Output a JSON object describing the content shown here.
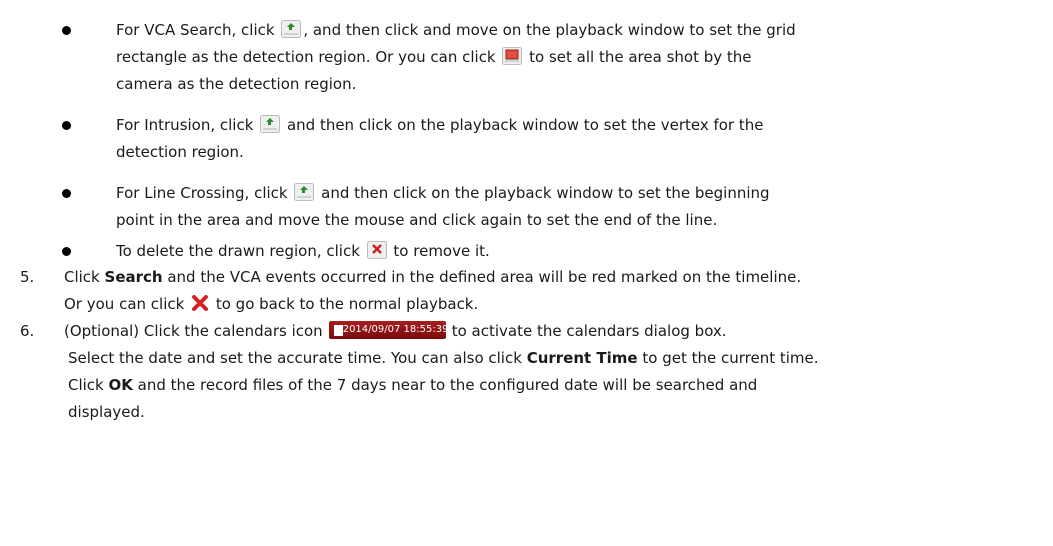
{
  "b1": {
    "l1a": "For VCA Search, click ",
    "l1b": ", and then click and move on the playback window to set the grid",
    "l2a": "rectangle as the detection region. Or you can click ",
    "l2b": " to set all the area shot by the",
    "l3": "camera as the detection region."
  },
  "b2": {
    "l1a": "For Intrusion, click ",
    "l1b": " and then click on the playback window to set the vertex for the",
    "l2": "detection region."
  },
  "b3": {
    "l1a": "For Line Crossing, click ",
    "l1b": " and then click on the playback window to set the beginning",
    "l2": "point in the area and move the mouse and click again to set the end of the line."
  },
  "b4": {
    "l1a": "To delete the drawn region, click ",
    "l1b": " to remove it."
  },
  "s5": {
    "num": "5.",
    "l1a": "Click ",
    "l1bold": "Search",
    "l1b": " and the VCA events occurred in the defined area will be red marked on the timeline.",
    "l2a": "Or you can click ",
    "l2b": " to go back to the normal playback."
  },
  "s6": {
    "num": "6.",
    "l1a": "(Optional) Click the calendars icon",
    "date": "2014/09/07 18:55:39",
    "l1b": "to activate the calendars dialog box.",
    "l2a": "Select the date and set the accurate time. You can also click ",
    "l2bold": "Current Time",
    "l2b": " to get the current time.",
    "l3a": "Click ",
    "l3bold": "OK",
    "l3b": " and the record files of the 7 days near to the configured date will be searched and",
    "l4": "displayed."
  },
  "icons": {
    "add": "add-region-icon",
    "fullscreen": "full-area-icon",
    "delete_small": "delete-region-icon",
    "delete": "close-icon",
    "calendar": "calendar-icon"
  }
}
